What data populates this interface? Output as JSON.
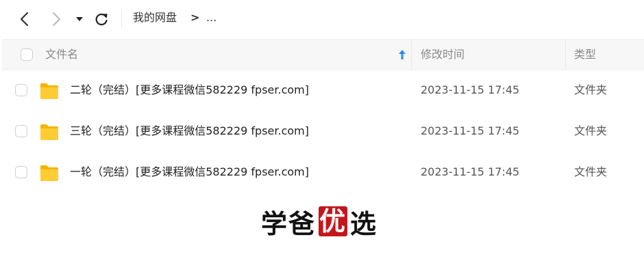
{
  "toolbar": {
    "back_icon": "chevron-left-icon",
    "forward_icon": "chevron-right-icon",
    "dropdown_icon": "caret-down-icon",
    "refresh_icon": "refresh-icon",
    "breadcrumb": {
      "root": "我的网盘",
      "separator": ">",
      "ellipsis": "..."
    }
  },
  "table": {
    "columns": {
      "name": "文件名",
      "modified": "修改时间",
      "type": "类型"
    },
    "sort_icon": "sort-up-arrow-icon",
    "rows": [
      {
        "name": "二轮（完结）[更多课程微信582229 fpser.com]",
        "modified": "2023-11-15 17:45",
        "type": "文件夹"
      },
      {
        "name": "三轮（完结）[更多课程微信582229 fpser.com]",
        "modified": "2023-11-15 17:45",
        "type": "文件夹"
      },
      {
        "name": "一轮（完结）[更多课程微信582229 fpser.com]",
        "modified": "2023-11-15 17:45",
        "type": "文件夹"
      }
    ]
  },
  "watermark": {
    "part1": "学爸",
    "boxed": "优",
    "part2": "选"
  },
  "colors": {
    "folder": "#ffcc33",
    "sort_arrow": "#2a8cf0",
    "watermark_box": "#c4161c"
  }
}
